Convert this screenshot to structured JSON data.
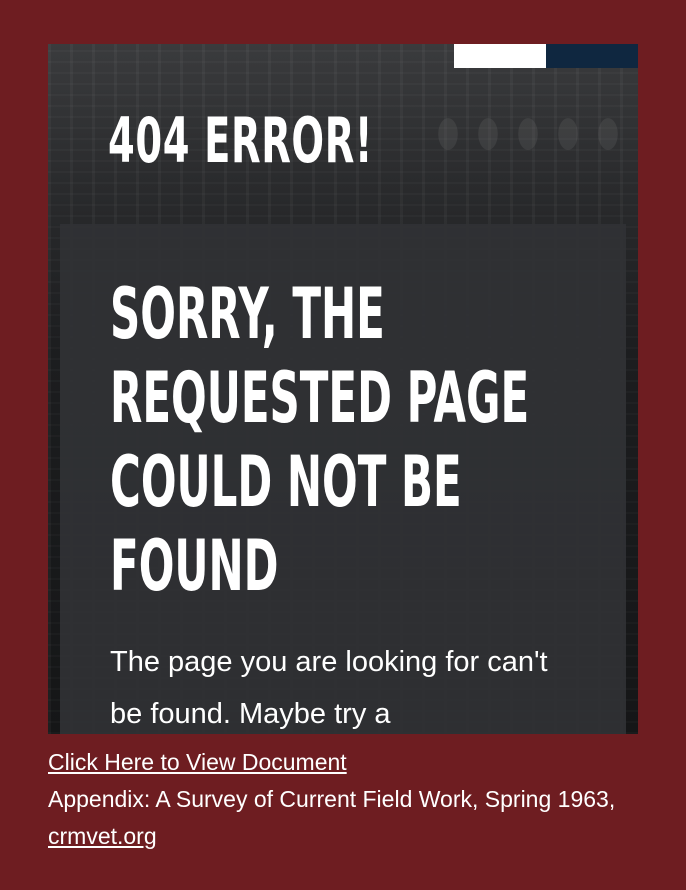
{
  "embed": {
    "error_title": "404 ERROR!",
    "heading": "SORRY, THE REQUESTED PAGE COULD NOT BE FOUND",
    "message": "The page you are looking for can't be found. Maybe try a"
  },
  "caption": {
    "view_link": "Click Here to View Document",
    "description": "Appendix: A Survey of Current Field Work, Spring 1963, ",
    "source_link": "crmvet.org"
  },
  "colors": {
    "page_background": "#6e1d21",
    "accent_white": "#ffffff",
    "accent_navy": "#0f2740",
    "panel": "#303235"
  }
}
